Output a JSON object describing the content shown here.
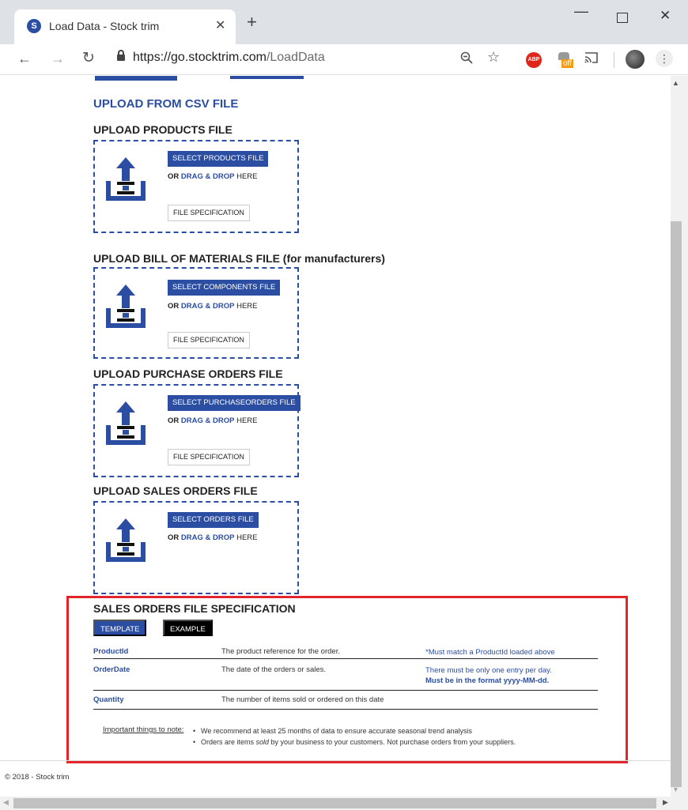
{
  "browser": {
    "tab_title": "Load Data - Stock trim",
    "favicon": "S",
    "url_host": "https://go.stocktrim.com",
    "url_path": "/LoadData",
    "abp_label": "ABP",
    "ext_off_label": "off",
    "icons": [
      "back-icon",
      "forward-icon",
      "reload-icon",
      "lock-icon",
      "zoom-icon",
      "star-icon",
      "cast-icon",
      "menu-icon"
    ]
  },
  "page": {
    "section_title": "UPLOAD FROM CSV FILE",
    "uploads": [
      {
        "title": "UPLOAD PRODUCTS FILE",
        "select_label": "SELECT PRODUCTS FILE",
        "spec_label": "FILE SPECIFICATION"
      },
      {
        "title": "UPLOAD BILL OF MATERIALS FILE (for manufacturers)",
        "select_label": "SELECT COMPONENTS FILE",
        "spec_label": "FILE SPECIFICATION"
      },
      {
        "title": "UPLOAD PURCHASE ORDERS FILE",
        "select_label": "SELECT PURCHASEORDERS FILE",
        "spec_label": "FILE SPECIFICATION"
      },
      {
        "title": "UPLOAD SALES ORDERS FILE",
        "select_label": "SELECT ORDERS FILE"
      }
    ],
    "drag": {
      "or": "OR",
      "drag_drop": "DRAG & DROP",
      "here": "HERE"
    },
    "spec": {
      "title": "SALES ORDERS FILE SPECIFICATION",
      "template_label": "TEMPLATE",
      "example_label": "EXAMPLE",
      "rows": [
        {
          "field": "ProductId",
          "desc": "The product reference for the order.",
          "note": "*Must match a ProductId loaded above",
          "note_bold": ""
        },
        {
          "field": "OrderDate",
          "desc": "The date of the orders or sales.",
          "note": "There must be only one entry per day.",
          "note_bold": "Must be in the format yyyy-MM-dd."
        },
        {
          "field": "Quantity",
          "desc": "The number of items sold or ordered on this date",
          "note": "",
          "note_bold": ""
        }
      ],
      "important_label": "Important things to note:",
      "important_1": "We recommend at least 25 months of data to ensure accurate seasonal trend analysis",
      "important_2_pre": "Orders are items ",
      "important_2_em": "sold",
      "important_2_post": " by your business to your customers. Not purchase orders from your suppliers."
    },
    "footer": "© 2018 - Stock trim"
  },
  "colors": {
    "accent": "#2b4ea2",
    "highlight": "#e0252b",
    "example_btn": "#000000"
  }
}
